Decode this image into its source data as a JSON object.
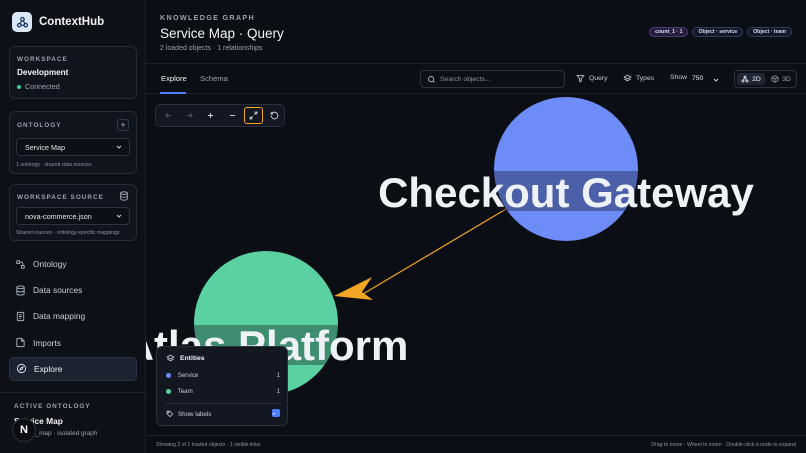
{
  "brand": {
    "name": "ContextHub"
  },
  "workspace": {
    "label": "WORKSPACE",
    "name": "Development",
    "status": "Connected"
  },
  "ontology": {
    "label": "ONTOLOGY",
    "selected": "Service Map",
    "hint": "1 ontology · shared data sources"
  },
  "workspace_source": {
    "label": "WORKSPACE SOURCE",
    "selected": "nova-commerce.json",
    "hint": "Shared sources · ontology-specific mappings"
  },
  "nav": {
    "items": [
      {
        "label": "Ontology",
        "icon": "ontology-icon"
      },
      {
        "label": "Data sources",
        "icon": "database-icon"
      },
      {
        "label": "Data mapping",
        "icon": "mapping-icon"
      },
      {
        "label": "Imports",
        "icon": "import-icon"
      },
      {
        "label": "Explore",
        "icon": "explore-icon",
        "active": true
      }
    ]
  },
  "active_ontology": {
    "label": "ACTIVE ONTOLOGY",
    "name": "Service Map",
    "desc": "a_map · isolated graph",
    "badge": "N"
  },
  "header": {
    "eyebrow": "KNOWLEDGE GRAPH",
    "title": "Service Map · Query",
    "subtitle": "2 loaded objects · 1 relationships",
    "chips": [
      "count_1 · 1",
      "Object · service",
      "Object · team"
    ]
  },
  "tabs": {
    "explore": "Explore",
    "schema": "Schema"
  },
  "toolbar": {
    "search_placeholder": "Search objects...",
    "query": "Query",
    "types": "Types",
    "show_label": "Show",
    "show_value": "750",
    "mode_2d": "2D",
    "mode_3d": "3D"
  },
  "graph": {
    "nodes": [
      {
        "label": "Checkout Gateway",
        "type": "Service",
        "color": "#6e8cf7"
      },
      {
        "label": "Atlas Platform",
        "type": "Team",
        "color": "#5bd1a2"
      }
    ],
    "edge_color": "#f5a524"
  },
  "legend": {
    "title": "Entities",
    "items": [
      {
        "label": "Service",
        "count": "1",
        "color": "#6e8cf7"
      },
      {
        "label": "Team",
        "count": "1",
        "color": "#5bd1a2"
      }
    ],
    "show_labels": "Show labels"
  },
  "status": {
    "left": "Showing 2 of 2 loaded objects · 1 visible links",
    "right": "Drag to move · Wheel to zoom · Double-click a node to expand"
  }
}
